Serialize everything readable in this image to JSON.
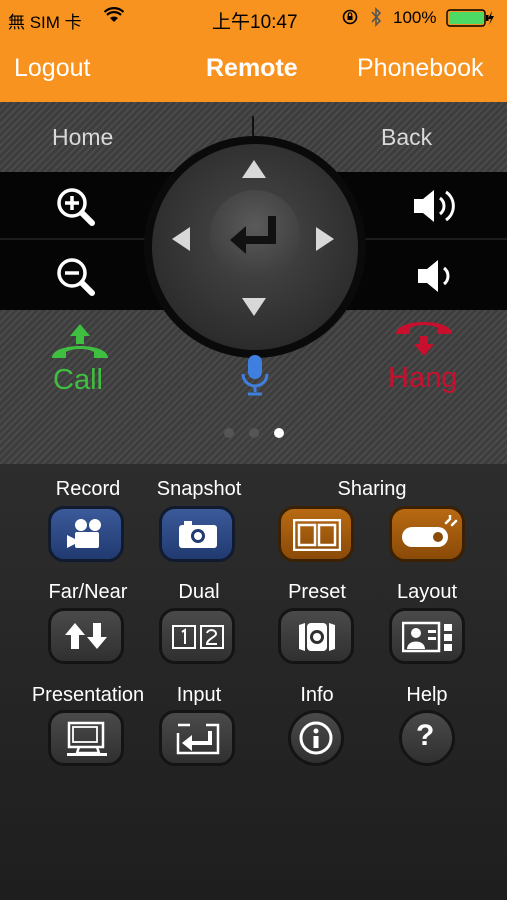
{
  "status": {
    "carrier": "無 SIM 卡",
    "time": "上午10:47",
    "battery": "100%"
  },
  "nav": {
    "logout": "Logout",
    "title": "Remote",
    "phonebook": "Phonebook"
  },
  "remote": {
    "home": "Home",
    "back": "Back",
    "call": "Call",
    "hang": "Hang",
    "page_dots": 3,
    "active_page": 3
  },
  "buttons": [
    {
      "label": "Record",
      "style": "blue",
      "icon": "video-camera-icon"
    },
    {
      "label": "Snapshot",
      "style": "blue",
      "icon": "camera-icon"
    },
    {
      "label": "Sharing",
      "style": "orange",
      "icon": "film-icon"
    },
    {
      "label": "",
      "style": "orange",
      "icon": "projector-icon"
    },
    {
      "label": "Far/Near",
      "style": "gray",
      "icon": "up-down-arrows-icon"
    },
    {
      "label": "Dual",
      "style": "gray",
      "icon": "dual-screen-icon"
    },
    {
      "label": "Preset",
      "style": "gray",
      "icon": "preset-icon"
    },
    {
      "label": "Layout",
      "style": "gray",
      "icon": "layout-icon"
    },
    {
      "label": "Presentation",
      "style": "gray",
      "icon": "presentation-icon"
    },
    {
      "label": "Input",
      "style": "gray",
      "icon": "input-icon"
    },
    {
      "label": "Info",
      "style": "gray",
      "icon": "info-icon"
    },
    {
      "label": "Help",
      "style": "gray",
      "icon": "help-icon"
    }
  ],
  "colors": {
    "nav_bg": "#f7931e",
    "call_green": "#3fbf3f",
    "hang_red": "#c8102e",
    "mic_blue": "#3f7fe0"
  }
}
